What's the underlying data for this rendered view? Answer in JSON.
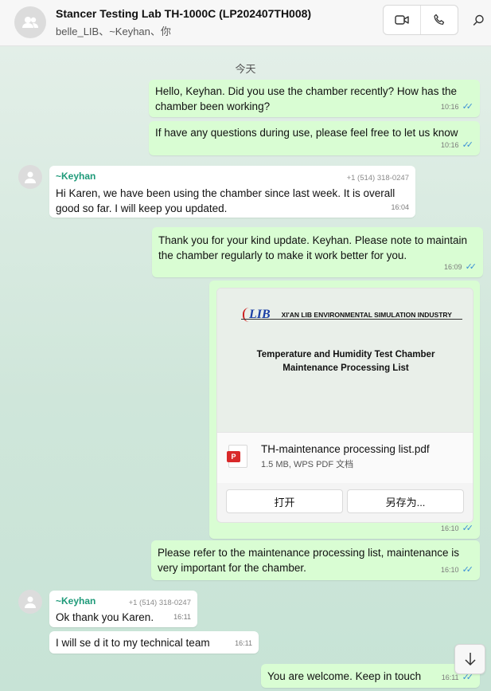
{
  "header": {
    "title": "Stancer Testing Lab TH-1000C (LP202407TH008)",
    "subtitle": "belle_LIB、~Keyhan、你",
    "icons": {
      "avatar": "group-icon",
      "video": "video-call-icon",
      "voice": "voice-call-icon",
      "search": "search-icon"
    }
  },
  "chat": {
    "date_separator": "今天",
    "messages": [
      {
        "direction": "out",
        "text": "Hello, Keyhan. Did you use the chamber recently?  How has the chamber been working?",
        "time": "10:16",
        "read": true
      },
      {
        "direction": "out",
        "text": "If have any questions during use, please feel free to let us know",
        "time": "10:16",
        "read": true
      },
      {
        "direction": "in",
        "sender": "~Keyhan",
        "phone": "+1 (514) 318-0247",
        "text": "Hi Karen, we have been using the chamber since last week. It is overall good so far. I will keep you updated.",
        "time": "16:04"
      },
      {
        "direction": "out",
        "text": "Thank you for your kind update. Keyhan. Please note to maintain the chamber regularly to make it work better for you.",
        "time": "16:09",
        "read": true
      },
      {
        "direction": "out",
        "type": "file",
        "time": "16:10",
        "read": true,
        "preview": {
          "logo": "LIB",
          "company": "XI'AN LIB ENVIRONMENTAL SIMULATION INDUSTRY",
          "doc_title_line1": "Temperature and Humidity Test Chamber",
          "doc_title_line2": "Maintenance Processing List"
        },
        "file_name": "TH-maintenance processing list.pdf",
        "file_meta": "1.5 MB, WPS PDF 文档",
        "file_icon": "pdf-file-icon",
        "open_label": "打开",
        "save_as_label": "另存为..."
      },
      {
        "direction": "out",
        "text": "Please refer to the maintenance processing list, maintenance is very important for the chamber.",
        "time": "16:10",
        "read": true
      },
      {
        "direction": "in",
        "sender": "~Keyhan",
        "phone": "+1 (514) 318-0247",
        "text": "Ok thank you Karen.",
        "time": "16:11"
      },
      {
        "direction": "in",
        "text": "I will se d it to my technical team",
        "time": "16:11"
      },
      {
        "direction": "out",
        "text": "You are welcome. Keep in touch",
        "time": "16:11",
        "read": true
      }
    ]
  },
  "scroll_down_icon": "arrow-down-icon",
  "read_receipt_glyph": "✓✓"
}
